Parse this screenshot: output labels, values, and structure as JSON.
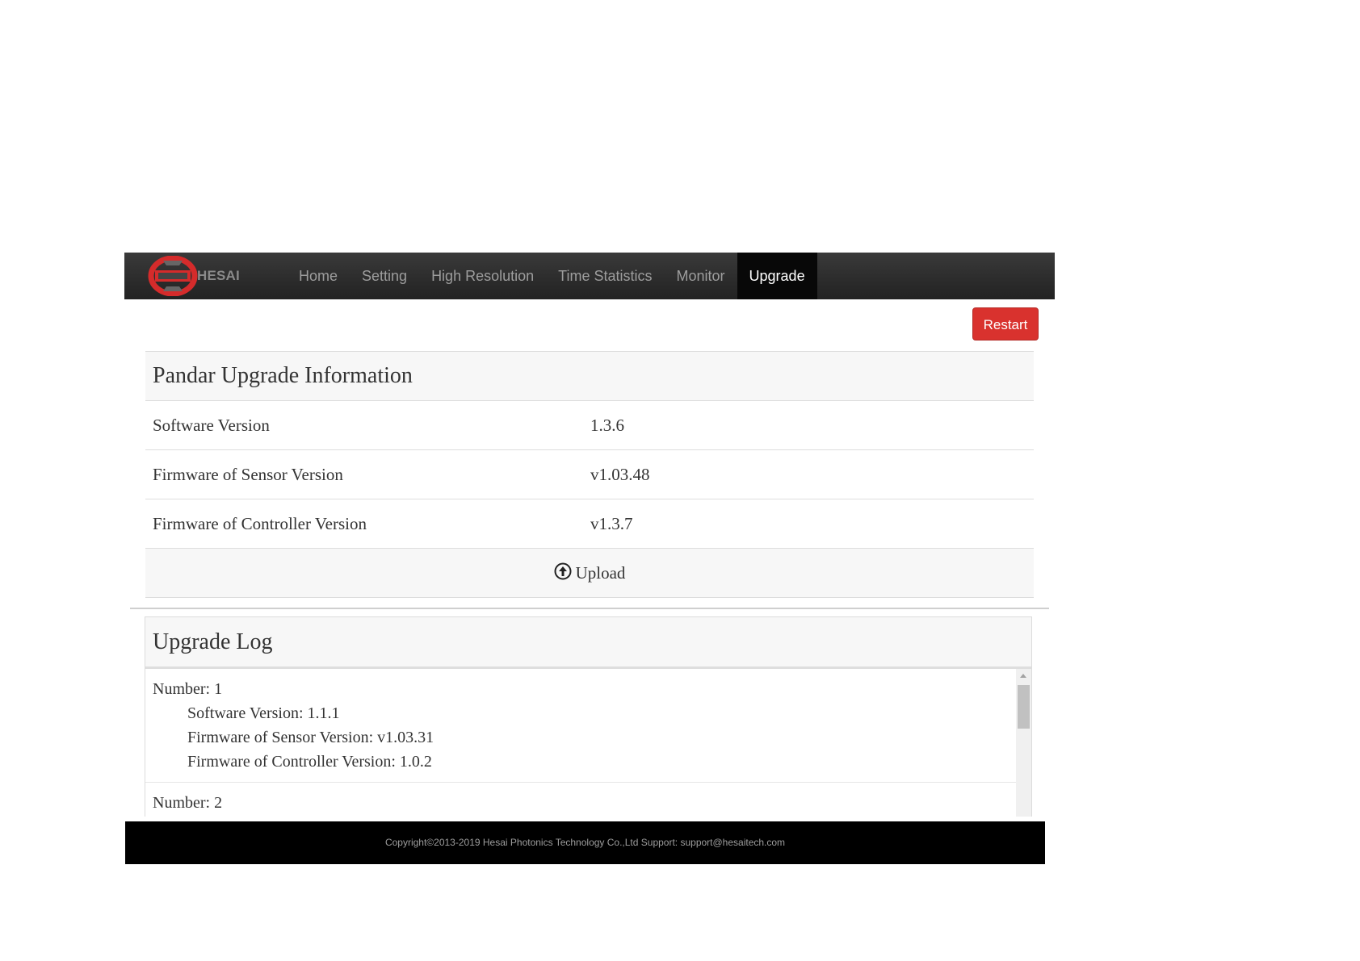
{
  "brand": {
    "name": "HESAI"
  },
  "nav": {
    "items": [
      {
        "label": "Home"
      },
      {
        "label": "Setting"
      },
      {
        "label": "High Resolution"
      },
      {
        "label": "Time Statistics"
      },
      {
        "label": "Monitor"
      },
      {
        "label": "Upgrade",
        "active": true
      }
    ]
  },
  "restart_label": "Restart",
  "info": {
    "title": "Pandar Upgrade Information",
    "rows": [
      {
        "label": "Software Version",
        "value": "1.3.6"
      },
      {
        "label": "Firmware of Sensor Version",
        "value": "v1.03.48"
      },
      {
        "label": "Firmware of Controller Version",
        "value": "v1.3.7"
      }
    ],
    "upload_label": "Upload"
  },
  "log": {
    "title": "Upgrade Log",
    "entries": [
      {
        "number": "Number: 1",
        "software": "Software Version: 1.1.1",
        "sensor": "Firmware of Sensor Version: v1.03.31",
        "controller": "Firmware of Controller Version: 1.0.2"
      },
      {
        "number": "Number: 2"
      }
    ]
  },
  "footer": {
    "text": "Copyright©2013-2019 Hesai Photonics Technology Co.,Ltd Support: support@hesaitech.com"
  },
  "colors": {
    "navbar": "#222222",
    "active_nav": "#080808",
    "restart": "#d9322e",
    "logo_red": "#d52b2b"
  },
  "icons": {
    "upload": "circle-arrow-up-icon",
    "logo": "hesai-logo-icon"
  }
}
